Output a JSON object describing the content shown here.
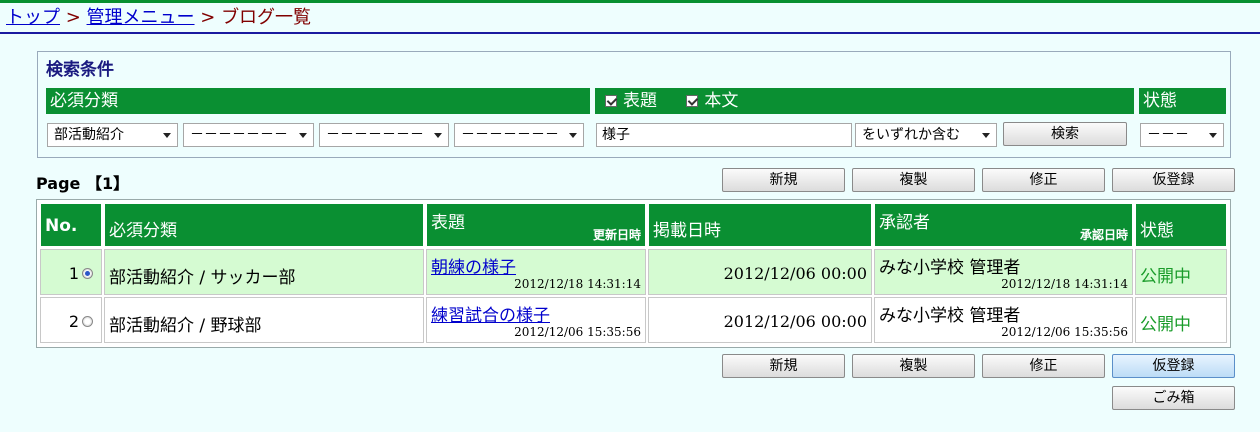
{
  "breadcrumb": {
    "top": "トップ",
    "sep1": " > ",
    "admin_menu": "管理メニュー",
    "sep2": " > ",
    "current": "ブログ一覧"
  },
  "search": {
    "title": "検索条件",
    "category_header": "必須分類",
    "title_check_label": "表題",
    "body_check_label": "本文",
    "status_header": "状態",
    "category_select_1": "部活動紹介",
    "category_select_2": "－－－－－－－",
    "category_select_3": "－－－－－－－",
    "category_select_4": "－－－－－－－",
    "keyword_value": "様子",
    "match_mode": "をいずれか含む",
    "search_button": "検索",
    "status_select": "－－－",
    "title_checked": true,
    "body_checked": true
  },
  "page_label": "Page 【1】",
  "toolbar": {
    "new": "新規",
    "copy": "複製",
    "edit": "修正",
    "provisional": "仮登録",
    "trash": "ごみ箱"
  },
  "table": {
    "headers": {
      "no": "No.",
      "category": "必須分類",
      "title": "表題",
      "updated": "更新日時",
      "published": "掲載日時",
      "approver": "承認者",
      "approved": "承認日時",
      "status": "状態"
    },
    "rows": [
      {
        "no": "1",
        "selected": true,
        "category": "部活動紹介 / サッカー部",
        "title": "朝練の様子",
        "updated": "2012/12/18 14:31:14",
        "published": "2012/12/06 00:00",
        "approver": "みな小学校 管理者",
        "approved": "2012/12/18 14:31:14",
        "status": "公開中"
      },
      {
        "no": "2",
        "selected": false,
        "category": "部活動紹介 / 野球部",
        "title": "練習試合の様子",
        "updated": "2012/12/06 15:35:56",
        "published": "2012/12/06 00:00",
        "approver": "みな小学校 管理者",
        "approved": "2012/12/06 15:35:56",
        "status": "公開中"
      }
    ]
  },
  "colors": {
    "header_green": "#0a8f32",
    "selected_row": "#d5fbd2",
    "status_green": "#1a9c2a",
    "link_blue": "#0000cc",
    "page_bg": "#eefefe"
  }
}
